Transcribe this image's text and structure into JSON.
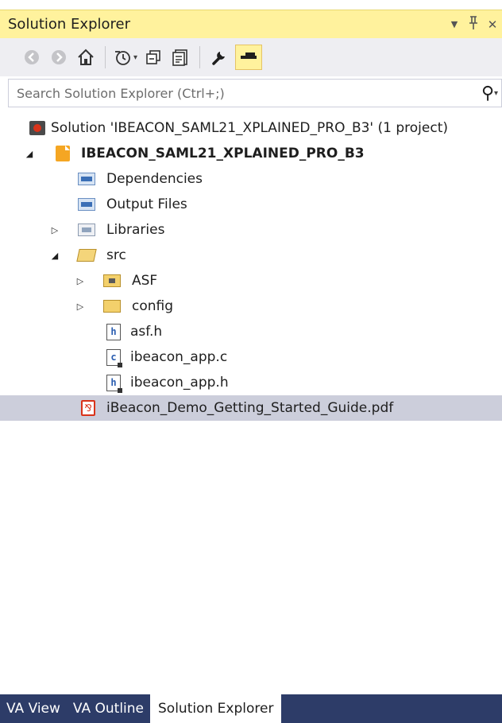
{
  "window": {
    "title": "Solution Explorer",
    "dropdown_glyph": "▼",
    "pin_glyph": "ᵖ",
    "close_glyph": "✕"
  },
  "toolbar": {
    "back_glyph": "◀",
    "forward_glyph": "▶",
    "home_glyph": "⌂",
    "history_glyph": "◷",
    "history_dropdown": "▾",
    "collapse_glyph": "⧉",
    "show_files_glyph": "▤",
    "properties_glyph": "🔧"
  },
  "search": {
    "placeholder": "Search Solution Explorer (Ctrl+;)",
    "icon": "⚲",
    "dropdown": "▾"
  },
  "tree": {
    "solution": "Solution 'IBEACON_SAML21_XPLAINED_PRO_B3' (1 project)",
    "project": "IBEACON_SAML21_XPLAINED_PRO_B3",
    "dependencies": "Dependencies",
    "output_files": "Output Files",
    "libraries": "Libraries",
    "src": "src",
    "asf": "ASF",
    "config": "config",
    "asf_h": "asf.h",
    "ibeacon_app_c": "ibeacon_app.c",
    "ibeacon_app_h": "ibeacon_app.h",
    "pdf": "iBeacon_Demo_Getting_Started_Guide.pdf",
    "arrow_expanded": "◢",
    "arrow_collapsed": "▷",
    "h_letter": "h",
    "c_letter": "c",
    "pdf_glyph": "⅋"
  },
  "tabs": [
    "VA View",
    "VA Outline",
    "Solution Explorer"
  ],
  "colors": {
    "title_active": "#fff29d",
    "toolbar_bg": "#eeeef2",
    "selection": "#cccedb",
    "tab_strip": "#2d3c68"
  }
}
